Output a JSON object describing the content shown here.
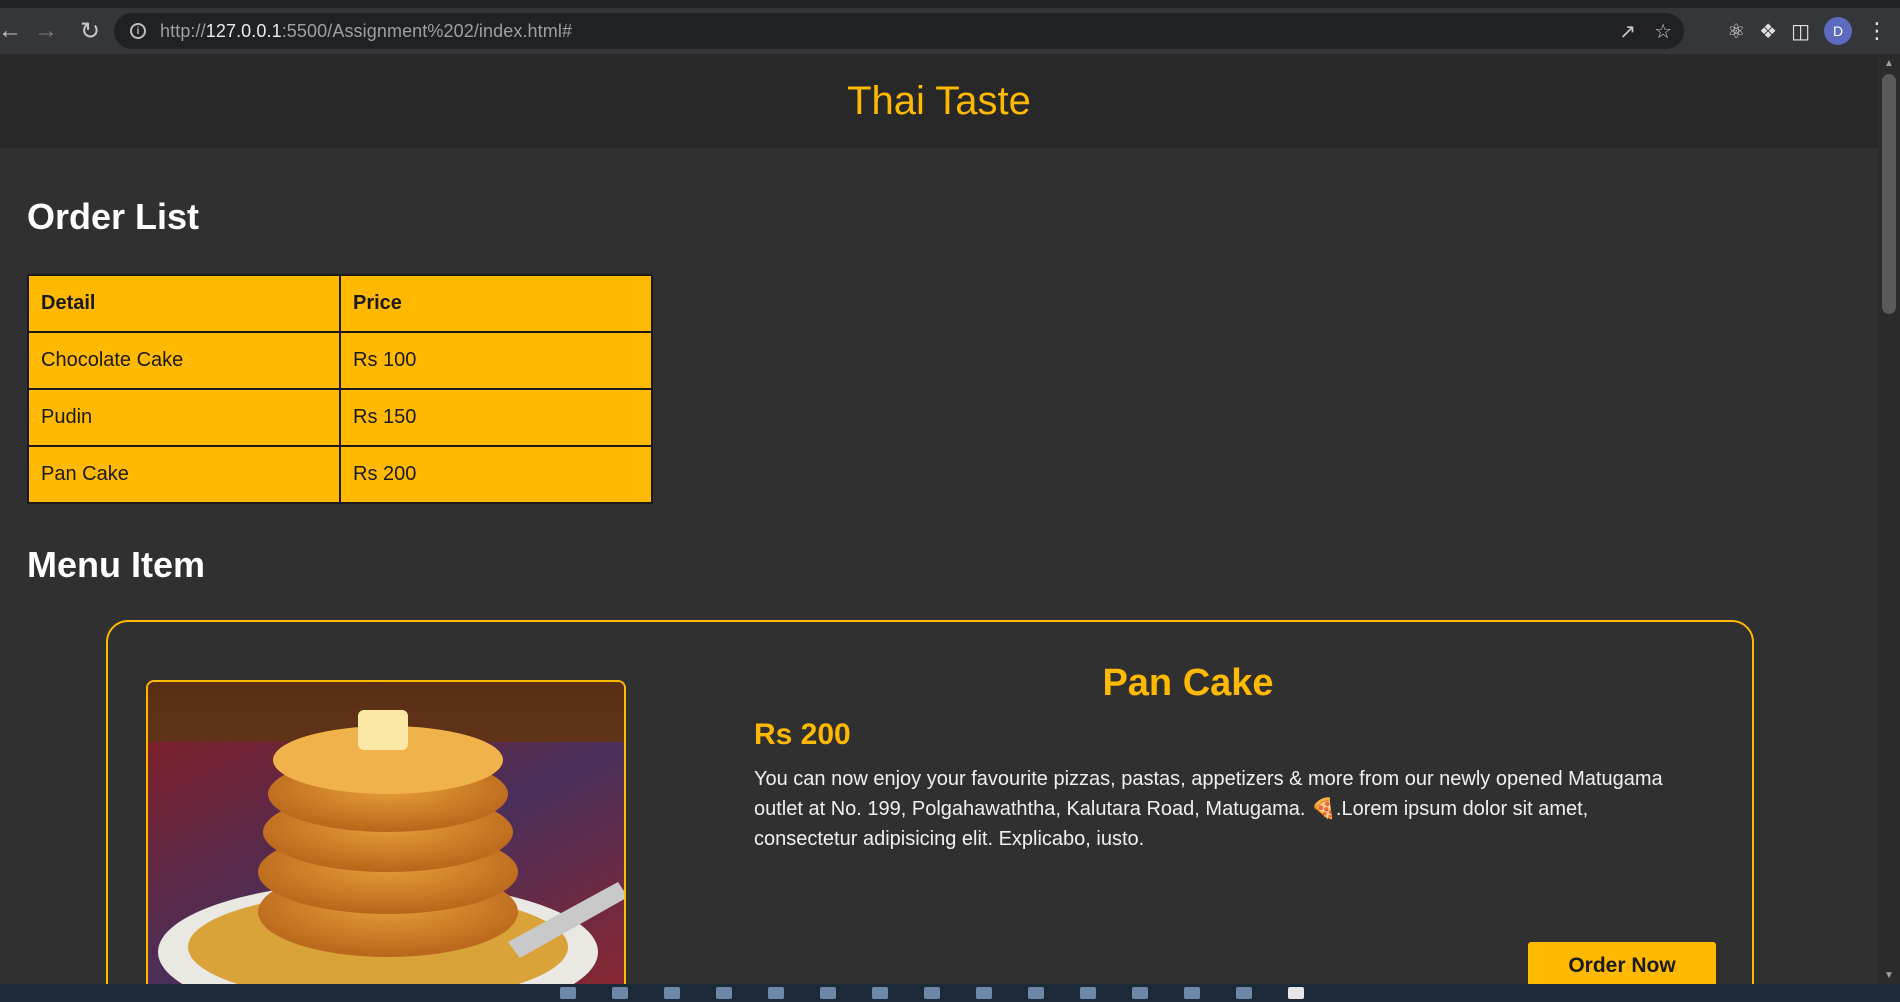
{
  "browser": {
    "url_prefix": "http://",
    "url_host": "127.0.0.1",
    "url_rest": ":5500/Assignment%202/index.html#",
    "profile_initial": "D"
  },
  "site": {
    "title": "Thai Taste"
  },
  "order_list": {
    "heading": "Order List",
    "columns": [
      "Detail",
      "Price"
    ],
    "rows": [
      {
        "detail": "Chocolate Cake",
        "price": "Rs 100"
      },
      {
        "detail": "Pudin",
        "price": "Rs 150"
      },
      {
        "detail": "Pan Cake",
        "price": "Rs 200"
      }
    ]
  },
  "menu": {
    "heading": "Menu Item",
    "item": {
      "name": "Pan Cake",
      "price": "Rs 200",
      "description": "You can now enjoy your favourite pizzas, pastas, appetizers & more from our newly opened Matugama outlet at No. 199, Polgahawaththa, Kalutara Road, Matugama. 🍕.Lorem ipsum dolor sit amet, consectetur adipisicing elit. Explicabo, iusto.",
      "image_alt": "pancake-stack-image",
      "button_label": "Order Now"
    }
  },
  "colors": {
    "accent": "#ffb900",
    "page_bg": "#303030",
    "header_bg": "#282828"
  }
}
